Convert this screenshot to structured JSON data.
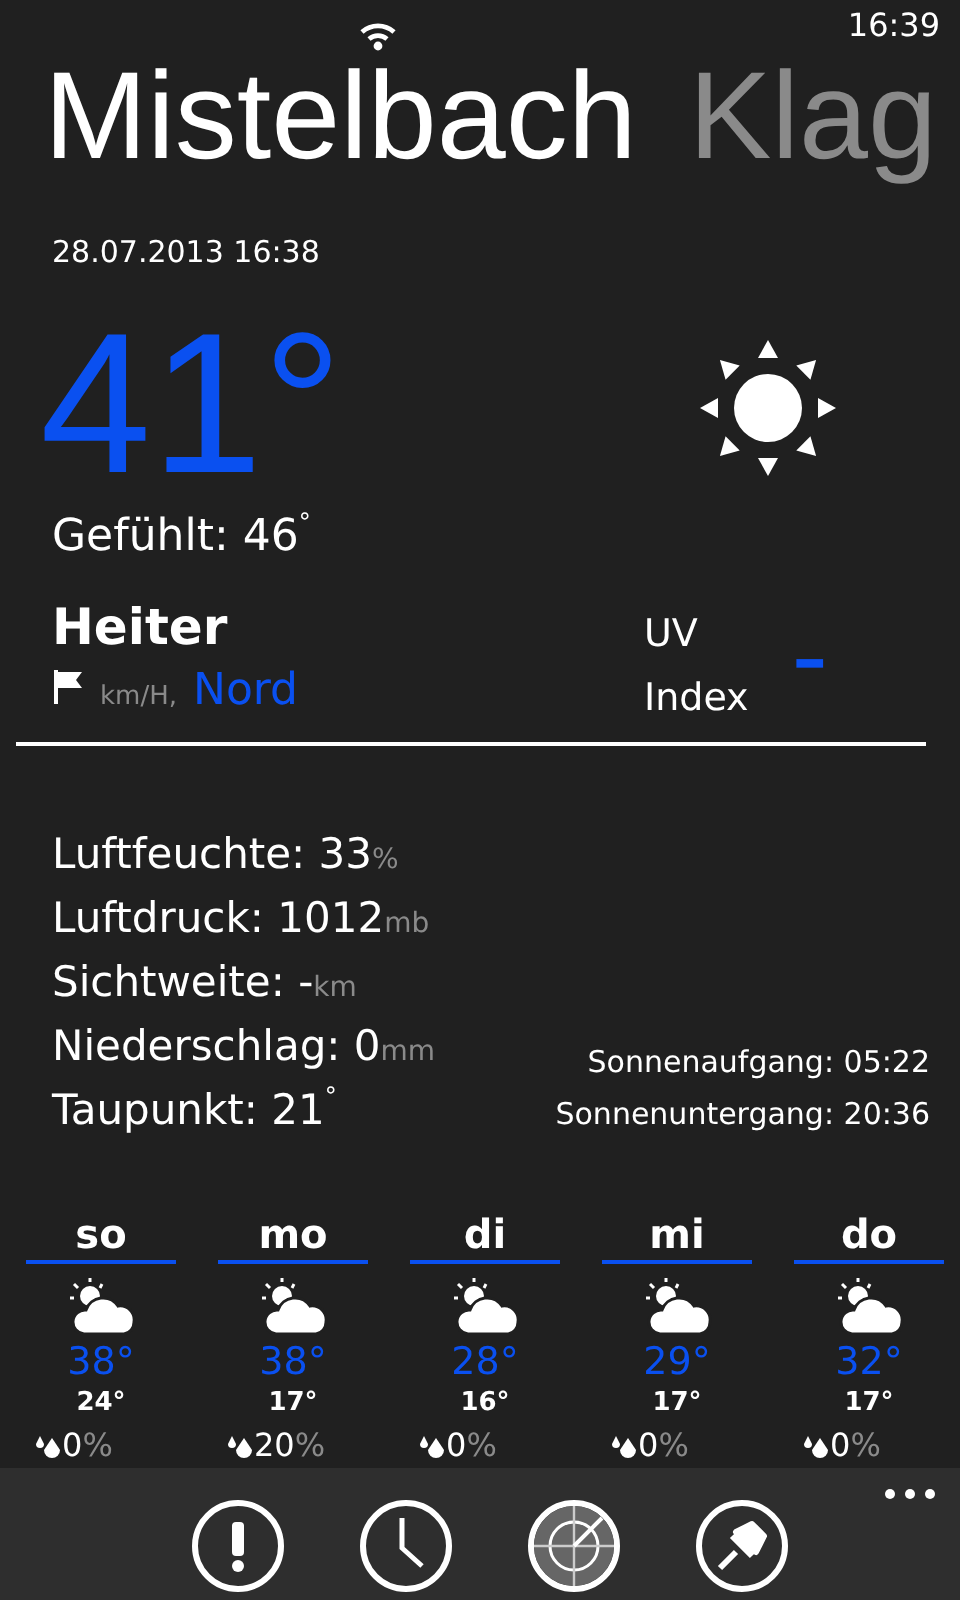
{
  "status_bar": {
    "time": "16:39"
  },
  "pivot": [
    {
      "label": "Mistelbach",
      "selected": true
    },
    {
      "label": "Klag",
      "selected": false
    }
  ],
  "date": "28.07.2013 16:38",
  "temperature": "41°",
  "feels_like": "Gefühlt: 46$^{°}$",
  "condition": "Heiter",
  "wind": {
    "unit": "km/H,",
    "direction": "Nord"
  },
  "uv": {
    "label_1": "UV",
    "label_2": "Index",
    "value": "–"
  },
  "details": [
    {
      "text": "Luftfeuchte: 33",
      "unit": "%"
    },
    {
      "text": "Luftdruck: 1012",
      "unit": "mb"
    },
    {
      "text": "Sichtweite: -",
      "unit": "km"
    },
    {
      "text": "Niederschlag: 0",
      "unit": "mm"
    },
    {
      "text": "Taupunkt: 21$^{°}$"
    }
  ],
  "sun": [
    "Sonnenaufgang: 05:22",
    "Sonnenuntergang: 20:36"
  ],
  "forecast": [
    {
      "day": "so",
      "high": "38°",
      "low": "24°",
      "precip": "0",
      "precip_unit": "%"
    },
    {
      "day": "mo",
      "high": "38°",
      "low": "17°",
      "precip": "20",
      "precip_unit": "%"
    },
    {
      "day": "di",
      "high": "28°",
      "low": "16°",
      "precip": "0",
      "precip_unit": "%"
    },
    {
      "day": "mi",
      "high": "29°",
      "low": "17°",
      "precip": "0",
      "precip_unit": "%"
    },
    {
      "day": "do",
      "high": "32°",
      "low": "17°",
      "precip": "0",
      "precip_unit": "%"
    }
  ]
}
